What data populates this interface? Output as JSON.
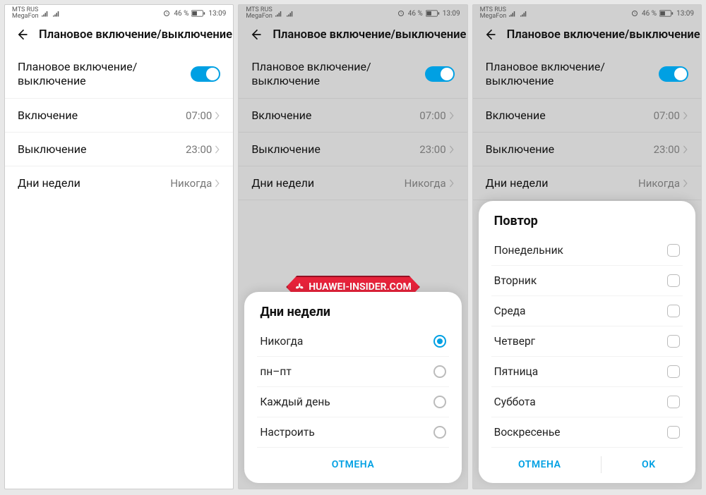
{
  "statusbar": {
    "carrier_line1": "MTS RUS",
    "carrier_line2": "MegaFon",
    "battery_text": "46 %",
    "time": "13:09"
  },
  "header": {
    "title": "Плановое включение/выключение"
  },
  "settings": {
    "toggle_label": "Плановое включение/\nвыключение",
    "turn_on_label": "Включение",
    "turn_on_value": "07:00",
    "turn_off_label": "Выключение",
    "turn_off_value": "23:00",
    "days_label": "Дни недели",
    "days_value": "Никогда"
  },
  "sheet_days": {
    "title": "Дни недели",
    "options": [
      {
        "label": "Никогда",
        "selected": true
      },
      {
        "label": "пн–пт",
        "selected": false
      },
      {
        "label": "Каждый день",
        "selected": false
      },
      {
        "label": "Настроить",
        "selected": false
      }
    ],
    "cancel": "ОТМЕНА"
  },
  "sheet_repeat": {
    "title": "Повтор",
    "options": [
      {
        "label": "Понедельник"
      },
      {
        "label": "Вторник"
      },
      {
        "label": "Среда"
      },
      {
        "label": "Четверг"
      },
      {
        "label": "Пятница"
      },
      {
        "label": "Суббота"
      },
      {
        "label": "Воскресенье"
      }
    ],
    "cancel": "ОТМЕНА",
    "ok": "OK"
  },
  "watermark": "HUAWEI-INSIDER.COM"
}
